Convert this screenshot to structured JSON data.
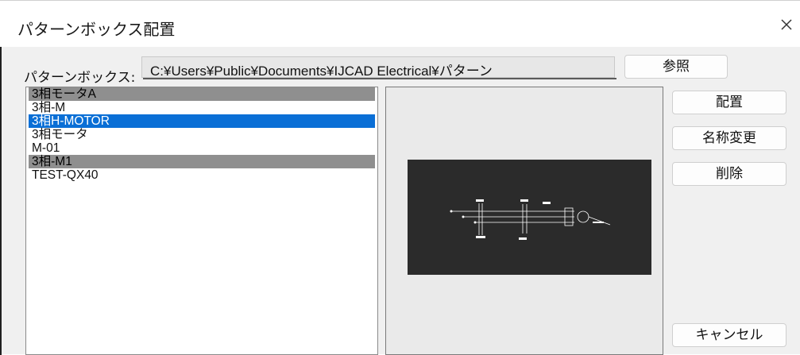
{
  "window": {
    "title": "パターンボックス配置"
  },
  "path": {
    "label": "パターンボックス:",
    "value": "C:¥Users¥Public¥Documents¥IJCAD Electrical¥パターン",
    "browse_label": "参照"
  },
  "list": {
    "items": [
      {
        "label": "3相モータA",
        "state": "highlighted"
      },
      {
        "label": "3相-M",
        "state": "normal"
      },
      {
        "label": "3相H-MOTOR",
        "state": "selected"
      },
      {
        "label": "3相モータ",
        "state": "normal"
      },
      {
        "label": "M-01",
        "state": "normal"
      },
      {
        "label": "3相-M1",
        "state": "highlighted"
      },
      {
        "label": "TEST-QX40",
        "state": "normal"
      }
    ]
  },
  "actions": {
    "place_label": "配置",
    "rename_label": "名称変更",
    "delete_label": "削除",
    "cancel_label": "キャンセル"
  },
  "colors": {
    "selection": "#0a6fd6",
    "highlight": "#8f8f8f",
    "preview_background": "#2b2b2b",
    "drawing_lines": "#ffffff"
  },
  "icons": {
    "close": "close-icon"
  }
}
